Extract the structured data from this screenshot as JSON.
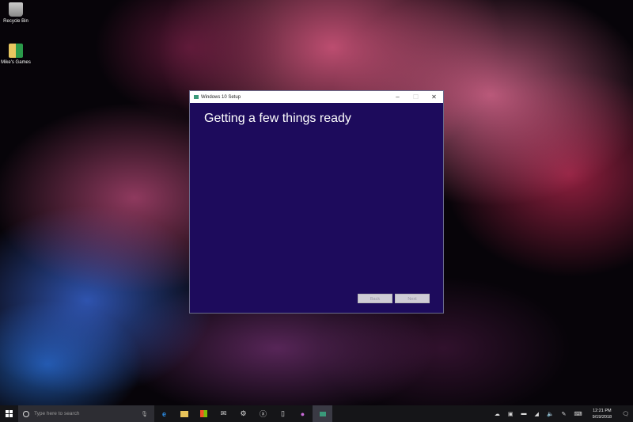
{
  "desktop": {
    "icons": [
      {
        "label": "Recycle Bin",
        "icon": "recycle-bin-icon"
      },
      {
        "label": "Mike's Games",
        "icon": "folder-icon"
      }
    ]
  },
  "window": {
    "title": "Windows 10 Setup",
    "heading": "Getting a few things ready",
    "back_label": "Back",
    "next_label": "Next",
    "minimize": "–",
    "maximize": "☐",
    "close": "✕",
    "bg_color": "#1d0b5c"
  },
  "taskbar": {
    "search_placeholder": "Type here to search",
    "time": "12:21 PM",
    "date": "9/19/2018"
  }
}
